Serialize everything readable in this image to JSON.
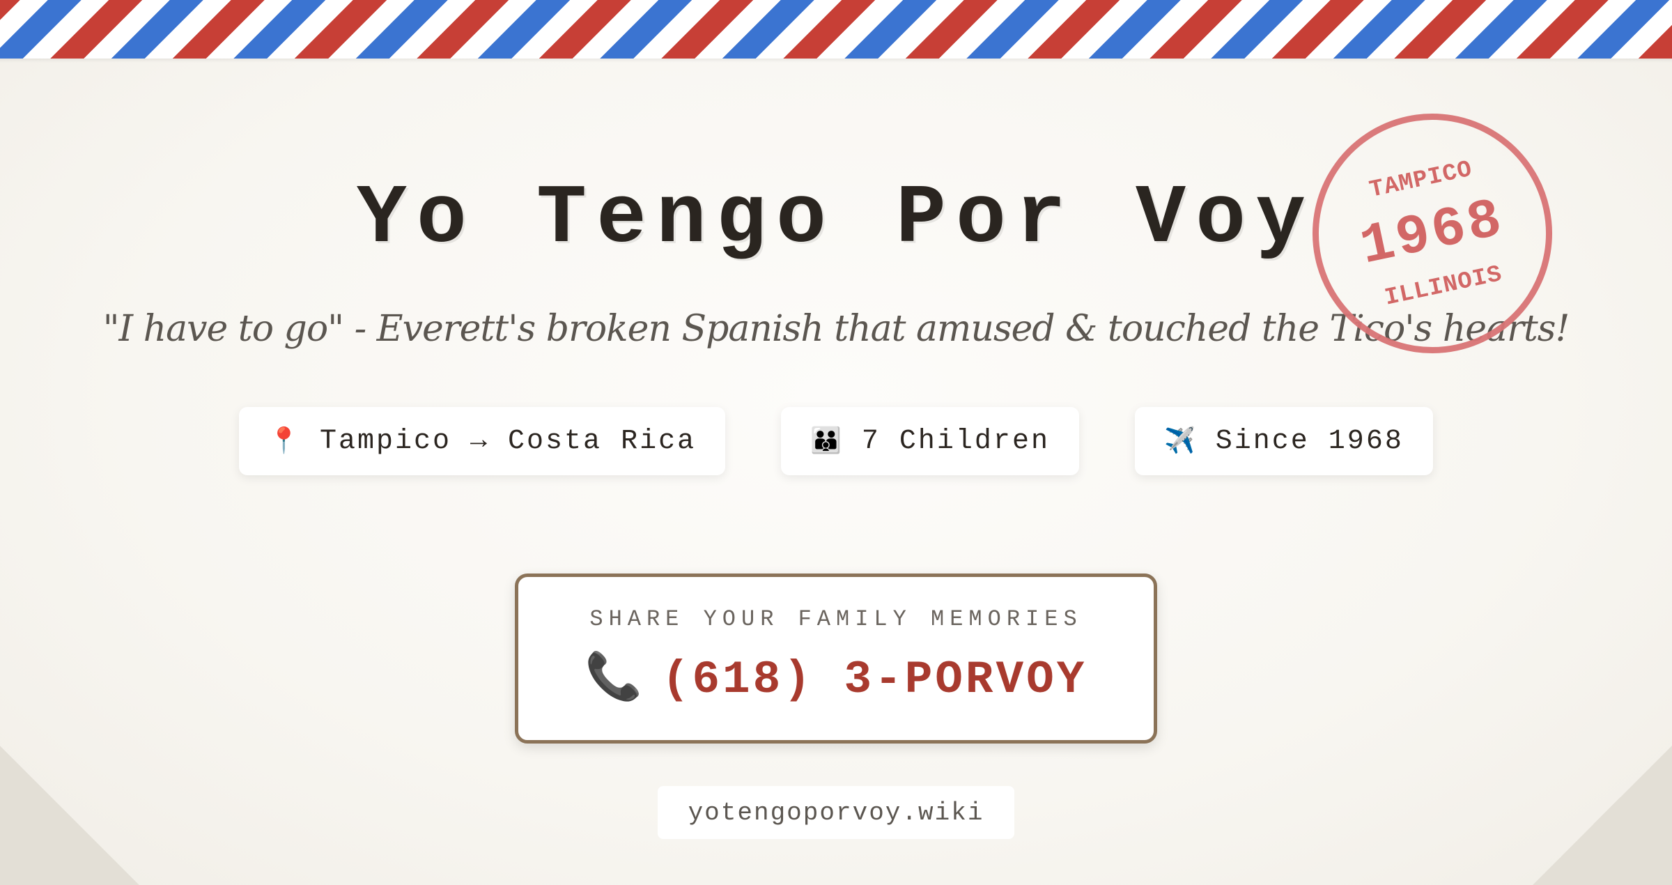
{
  "header": {
    "title": "Yo Tengo Por Voy",
    "subtitle": "\"I have to go\" - Everett's broken Spanish that amused & touched the Tico's hearts!"
  },
  "stamp": {
    "top": "TAMPICO",
    "year": "1968",
    "bottom": "ILLINOIS",
    "color": "#d0605f"
  },
  "badges": [
    {
      "icon": "📍",
      "icon_name": "pin-icon",
      "label": "Tampico → Costa Rica"
    },
    {
      "icon": "👪",
      "icon_name": "family-icon",
      "label": "7 Children"
    },
    {
      "icon": "✈️",
      "icon_name": "airplane-icon",
      "label": "Since 1968"
    }
  ],
  "contact": {
    "label": "SHARE YOUR FAMILY MEMORIES",
    "icon": "📞",
    "icon_name": "telephone-icon",
    "phone": "(618) 3-PORVOY",
    "phone_color": "#a83a2e",
    "border_color": "#8b7358"
  },
  "footer": {
    "url": "yotengoporvoy.wiki"
  },
  "theme": {
    "airmail_red": "#c73f36",
    "airmail_blue": "#3b74d1",
    "paper": "#f8f6f1"
  }
}
